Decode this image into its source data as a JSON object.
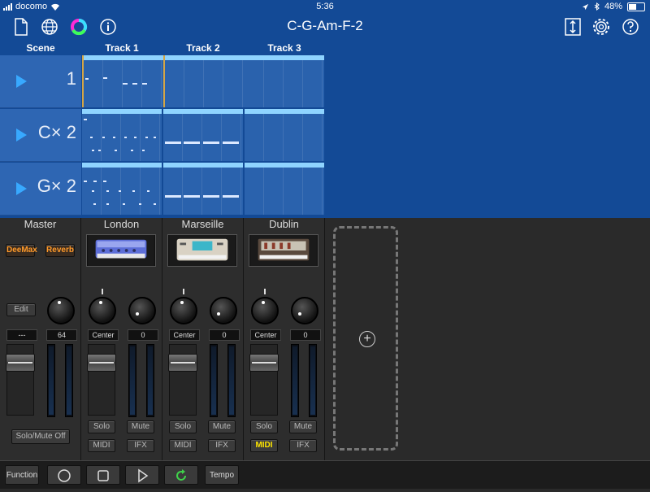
{
  "status_bar": {
    "carrier": "docomo",
    "time": "5:36",
    "battery": "48%"
  },
  "nav": {
    "song_title": "C-G-Am-F-2"
  },
  "columns": {
    "scene_header": "Scene",
    "tracks": [
      "Track 1",
      "Track 2",
      "Track 3"
    ]
  },
  "scenes": [
    {
      "label": "1"
    },
    {
      "label": "C× 2"
    },
    {
      "label": "G× 2"
    }
  ],
  "master": {
    "name": "Master",
    "fx": [
      "DeeMax",
      "Reverb"
    ],
    "edit_label": "Edit",
    "pan_value": "---",
    "volume_value": "64",
    "solo_mute_off_label": "Solo/Mute Off"
  },
  "channels": [
    {
      "name": "London",
      "pan": "Center",
      "fx_value": "0",
      "solo": "Solo",
      "mute": "Mute",
      "midi": "MIDI",
      "ifx": "IFX",
      "midi_active": false
    },
    {
      "name": "Marseille",
      "pan": "Center",
      "fx_value": "0",
      "solo": "Solo",
      "mute": "Mute",
      "midi": "MIDI",
      "ifx": "IFX",
      "midi_active": false
    },
    {
      "name": "Dublin",
      "pan": "Center",
      "fx_value": "0",
      "solo": "Solo",
      "mute": "Mute",
      "midi": "MIDI",
      "ifx": "IFX",
      "midi_active": true
    }
  ],
  "toolbar": {
    "function_label": "Function",
    "tempo_label": "Tempo"
  },
  "colors": {
    "top_bg": "#134a96",
    "accent_blue": "#38a9ff",
    "midi_active": "#ffe600",
    "refresh_green": "#3fd24a",
    "fx_orange": "#ff9a2a"
  },
  "icons": [
    "document-icon",
    "globe-icon",
    "color-wheel-icon",
    "info-icon",
    "resize-icon",
    "gear-icon",
    "help-icon"
  ]
}
